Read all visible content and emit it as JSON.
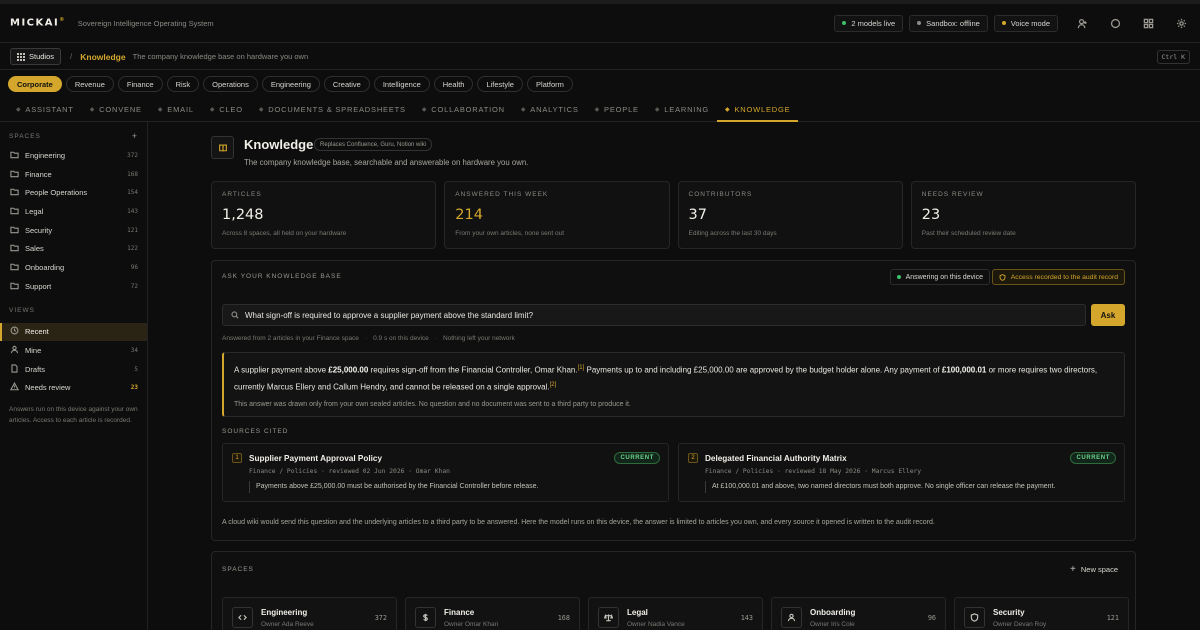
{
  "brand": {
    "logo": "MICKAI",
    "logo_mark": "®",
    "tagline": "Sovereign Intelligence Operating System"
  },
  "topbar": {
    "status": [
      {
        "label": "2 models live",
        "color": "#3fbf6a"
      },
      {
        "label": "Sandbox: offline",
        "color": "#8c8a84"
      },
      {
        "label": "Voice mode",
        "color": "#d4a72c"
      }
    ],
    "icons": [
      "user-icon",
      "circle-icon",
      "grid-icon",
      "gear-icon"
    ]
  },
  "breadcrumb": {
    "studios_label": "Studios",
    "separator": "/",
    "current": "Knowledge",
    "description": "The company knowledge base on hardware you own",
    "shortcut": "Ctrl K"
  },
  "categories": [
    "Corporate",
    "Revenue",
    "Finance",
    "Risk",
    "Operations",
    "Engineering",
    "Creative",
    "Intelligence",
    "Health",
    "Lifestyle",
    "Platform"
  ],
  "active_category": "Corporate",
  "tabs": [
    "ASSISTANT",
    "CONVENE",
    "EMAIL",
    "CLEO",
    "DOCUMENTS & SPREADSHEETS",
    "COLLABORATION",
    "ANALYTICS",
    "PEOPLE",
    "LEARNING",
    "KNOWLEDGE"
  ],
  "active_tab": "KNOWLEDGE",
  "sidebar": {
    "spaces_heading": "SPACES",
    "add_label": "+",
    "spaces": [
      {
        "label": "Engineering",
        "count": "372"
      },
      {
        "label": "Finance",
        "count": "168"
      },
      {
        "label": "People Operations",
        "count": "154"
      },
      {
        "label": "Legal",
        "count": "143"
      },
      {
        "label": "Security",
        "count": "121"
      },
      {
        "label": "Sales",
        "count": "122"
      },
      {
        "label": "Onboarding",
        "count": "96"
      },
      {
        "label": "Support",
        "count": "72"
      }
    ],
    "views_heading": "VIEWS",
    "views": [
      {
        "label": "Recent",
        "count": "",
        "icon": "clock-icon"
      },
      {
        "label": "Mine",
        "count": "34",
        "icon": "user-icon"
      },
      {
        "label": "Drafts",
        "count": "5",
        "icon": "file-icon"
      },
      {
        "label": "Needs review",
        "count": "23",
        "icon": "warning-icon"
      }
    ],
    "note": "Answers run on this device against your own articles. Access to each article is recorded."
  },
  "page": {
    "title": "Knowledge",
    "replaces": "Replaces Confluence, Guru, Notion wiki",
    "subtitle": "The company knowledge base, searchable and answerable on hardware you own."
  },
  "stats": [
    {
      "label": "ARTICLES",
      "value": "1,248",
      "desc": "Across 8 spaces, all held on your hardware"
    },
    {
      "label": "ANSWERED THIS WEEK",
      "value": "214",
      "desc": "From your own articles, none sent out"
    },
    {
      "label": "CONTRIBUTORS",
      "value": "37",
      "desc": "Editing across the last 30 days"
    },
    {
      "label": "NEEDS REVIEW",
      "value": "23",
      "desc": "Past their scheduled review date"
    }
  ],
  "ask": {
    "heading": "ASK YOUR KNOWLEDGE BASE",
    "device_status": "Answering on this device",
    "audit_label": "Access recorded to the audit record",
    "query": "What sign-off is required to approve a supplier payment above the standard limit?",
    "button": "Ask",
    "meta": [
      "Answered from 2 articles in your Finance space",
      "0.9 s on this device",
      "Nothing left your network"
    ],
    "answer": {
      "p1": "A supplier payment above ",
      "b1": "£25,000.00",
      "p2": " requires sign-off from the Financial Controller, Omar Khan.",
      "ref1": "[1]",
      "p3": " Payments up to and including £25,000.00 are approved by the budget holder alone. Any payment of ",
      "b2": "£100,000.01",
      "p4": " or more requires two directors, currently Marcus Ellery and Callum Hendry, and cannot be released on a single approval.",
      "ref2": "[2]",
      "note": "This answer was drawn only from your own sealed articles. No question and no document was sent to a third party to produce it."
    },
    "sources_heading": "SOURCES CITED",
    "sources": [
      {
        "num": "1",
        "title": "Supplier Payment Approval Policy",
        "badge": "CURRENT",
        "path": "Finance / Policies · reviewed 02 Jun 2026 · Omar Khan",
        "quote": "Payments above £25,000.00 must be authorised by the Financial Controller before release."
      },
      {
        "num": "2",
        "title": "Delegated Financial Authority Matrix",
        "badge": "CURRENT",
        "path": "Finance / Policies · reviewed 18 May 2026 · Marcus Ellery",
        "quote": "At £100,000.01 and above, two named directors must both approve. No single officer can release the payment."
      }
    ],
    "cloud_note": "A cloud wiki would send this question and the underlying articles to a third party to be answered. Here the model runs on this device, the answer is limited to articles you own, and every source it opened is written to the audit record."
  },
  "spaces_panel": {
    "heading": "SPACES",
    "new_label": "New space",
    "cards": [
      {
        "name": "Engineering",
        "owner": "Owner Ada Reeve",
        "count": "372",
        "icon": "code-icon"
      },
      {
        "name": "Finance",
        "owner": "Owner Omar Khan",
        "count": "168",
        "icon": "dollar-icon"
      },
      {
        "name": "Legal",
        "owner": "Owner Nadia Vance",
        "count": "143",
        "icon": "scales-icon"
      },
      {
        "name": "Onboarding",
        "owner": "Owner Iris Cole",
        "count": "96",
        "icon": "person-icon"
      },
      {
        "name": "Security",
        "owner": "Owner Devan Roy",
        "count": "121",
        "icon": "shield-icon"
      }
    ]
  },
  "colors": {
    "accent": "#d4a72c",
    "live": "#3fbf6a",
    "current_badge": "#6bd38a",
    "background": "#0d0d0d"
  }
}
